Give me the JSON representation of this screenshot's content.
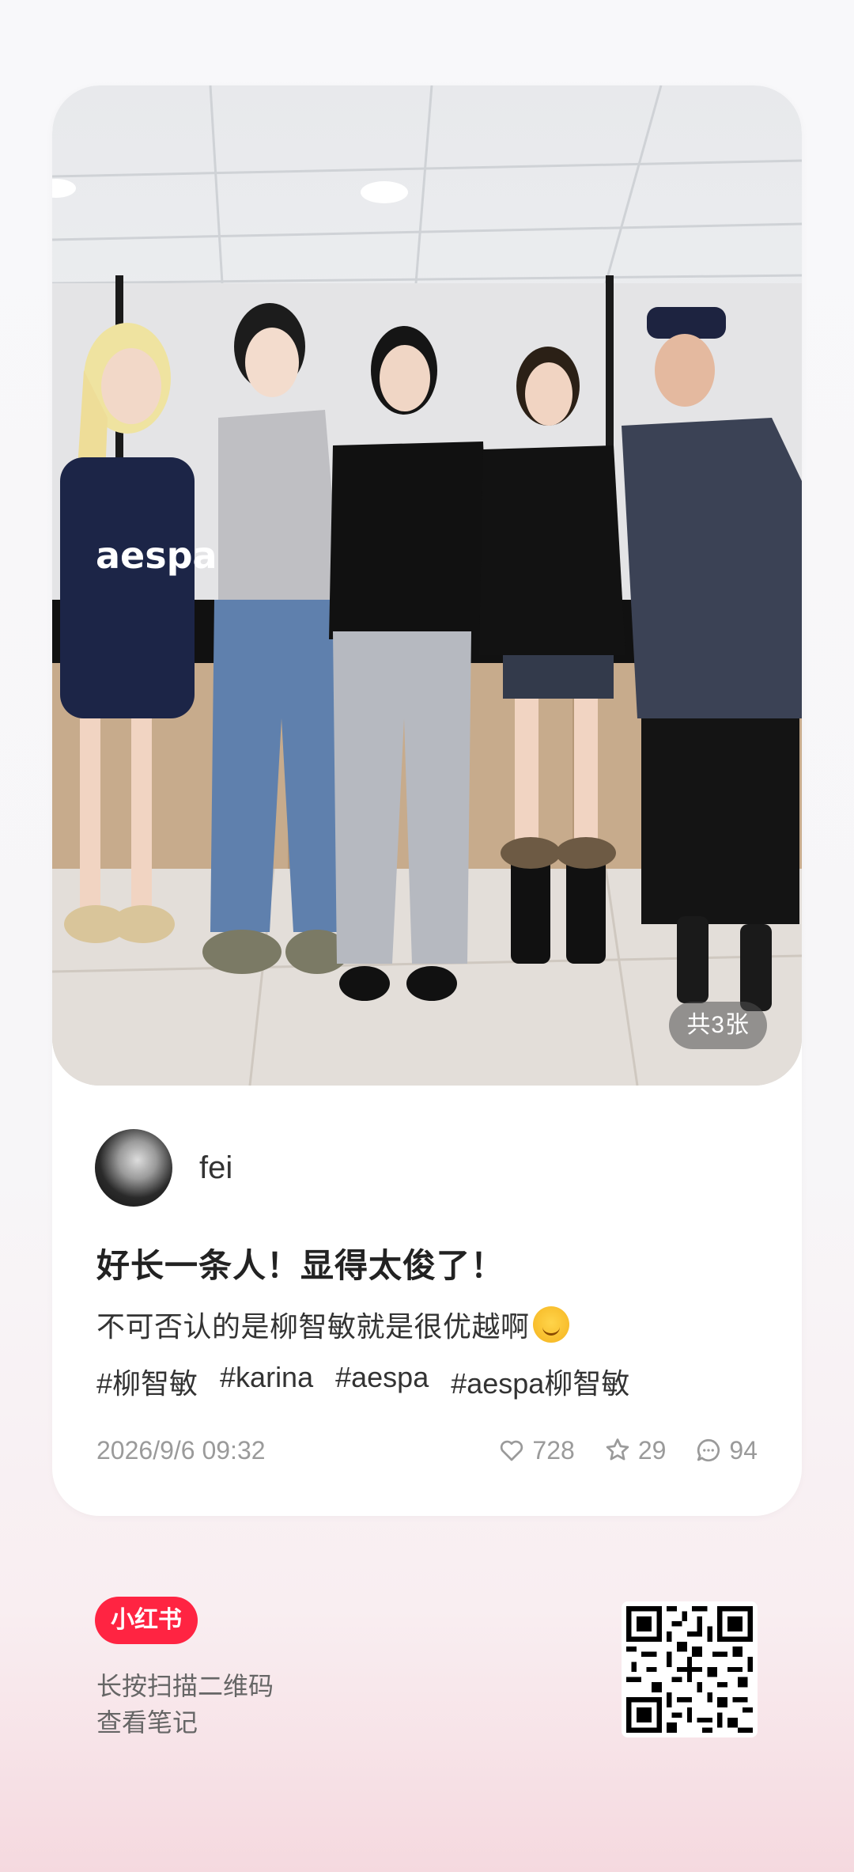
{
  "post": {
    "image_count": "共3张",
    "author": "fei",
    "title": "好长一条人！显得太俊了！",
    "description": "不可否认的是柳智敏就是很优越啊",
    "tags": [
      "#柳智敏",
      "#karina",
      "#aespa",
      "#aespa柳智敏"
    ],
    "date": "2026/9/6 09:32",
    "likes": "728",
    "collects": "29",
    "comments": "94"
  },
  "footer": {
    "logo_text": "小红书",
    "line1": "长按扫描二维码",
    "line2": "查看笔记"
  },
  "colors": {
    "brand": "#ff2442",
    "meta_gray": "#9a9a9a"
  }
}
